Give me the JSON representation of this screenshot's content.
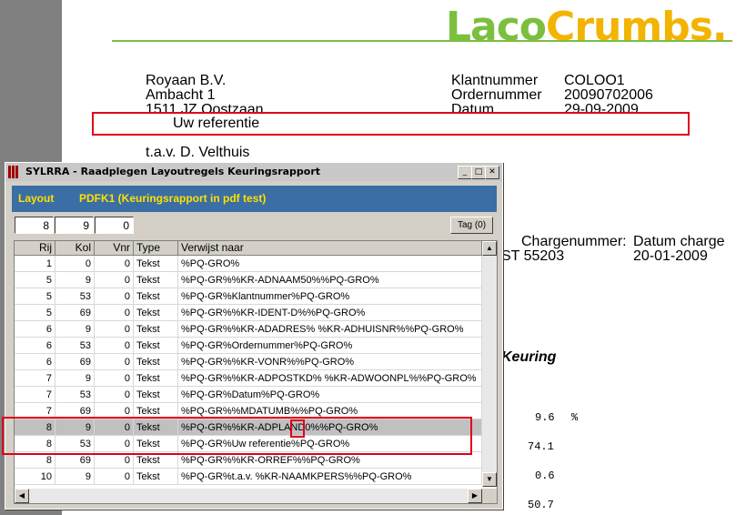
{
  "document": {
    "logo": {
      "part1": "Laco",
      "part2": "Crumbs."
    },
    "address": [
      "Royaan B.V.",
      "Ambacht 1",
      "1511 JZ  Oostzaan"
    ],
    "reference_label": "Uw referentie",
    "attention": "t.a.v. D. Velthuis",
    "meta_labels": [
      "Klantnummer",
      "Ordernummer",
      "Datum"
    ],
    "meta_values": [
      "COLOO1",
      "20090702006",
      "29-09-2009"
    ],
    "charge_headers": [
      "Chargenummer:",
      "Datum charge"
    ],
    "charge_values": [
      "ST 55203",
      "20-01-2009"
    ],
    "section_heading": "Keuring",
    "numbers": [
      "9.6",
      "%",
      "74.1",
      "0.6",
      "50.7"
    ]
  },
  "dialog": {
    "title": "SYLRRA - Raadplegen Layoutregels Keuringsrapport",
    "window_buttons": {
      "minimize": "_",
      "maximize": "□",
      "close": "✕"
    },
    "layout_label": "Layout",
    "layout_value": "PDFK1  (Keuringsrapport in pdf test)",
    "fields": [
      "8",
      "9",
      "0"
    ],
    "tag_button": "Tag (0)",
    "columns": [
      "Rij",
      "Kol",
      "Vnr",
      "Type",
      "Verwijst naar"
    ],
    "rows": [
      [
        "1",
        "0",
        "0",
        "Tekst",
        "%PQ-GRO%"
      ],
      [
        "5",
        "9",
        "0",
        "Tekst",
        "%PQ-GR%%KR-ADNAAM50%%PQ-GRO%"
      ],
      [
        "5",
        "53",
        "0",
        "Tekst",
        "%PQ-GR%Klantnummer%PQ-GRO%"
      ],
      [
        "5",
        "69",
        "0",
        "Tekst",
        "%PQ-GR%%KR-IDENT-D%%PQ-GRO%"
      ],
      [
        "6",
        "9",
        "0",
        "Tekst",
        "%PQ-GR%%KR-ADADRES% %KR-ADHUISNR%%PQ-GRO%"
      ],
      [
        "6",
        "53",
        "0",
        "Tekst",
        "%PQ-GR%Ordernummer%PQ-GRO%"
      ],
      [
        "6",
        "69",
        "0",
        "Tekst",
        "%PQ-GR%%KR-VONR%%PQ-GRO%"
      ],
      [
        "7",
        "9",
        "0",
        "Tekst",
        "%PQ-GR%%KR-ADPOSTKD%  %KR-ADWOONPL%%PQ-GRO%"
      ],
      [
        "7",
        "53",
        "0",
        "Tekst",
        "%PQ-GR%Datum%PQ-GRO%"
      ],
      [
        "7",
        "69",
        "0",
        "Tekst",
        "%PQ-GR%%MDATUMB%%PQ-GRO%"
      ],
      [
        "8",
        "9",
        "0",
        "Tekst",
        "%PQ-GR%%KR-ADPLAND0%%PQ-GRO%"
      ],
      [
        "8",
        "53",
        "0",
        "Tekst",
        "%PQ-GR%Uw referentie%PQ-GRO%"
      ],
      [
        "8",
        "69",
        "0",
        "Tekst",
        "%PQ-GR%%KR-ORREF%%PQ-GRO%"
      ],
      [
        "10",
        "9",
        "0",
        "Tekst",
        "%PQ-GR%t.a.v. %KR-NAAMKPERS%%PQ-GRO%"
      ]
    ],
    "selected_row": 10,
    "scroll_arrows": {
      "up": "▲",
      "down": "▼",
      "left": "◀",
      "right": "▶"
    }
  },
  "colors": {
    "highlight": "#e0001a",
    "layout_bar": "#3a6ea5",
    "layout_text": "#ffe000"
  }
}
